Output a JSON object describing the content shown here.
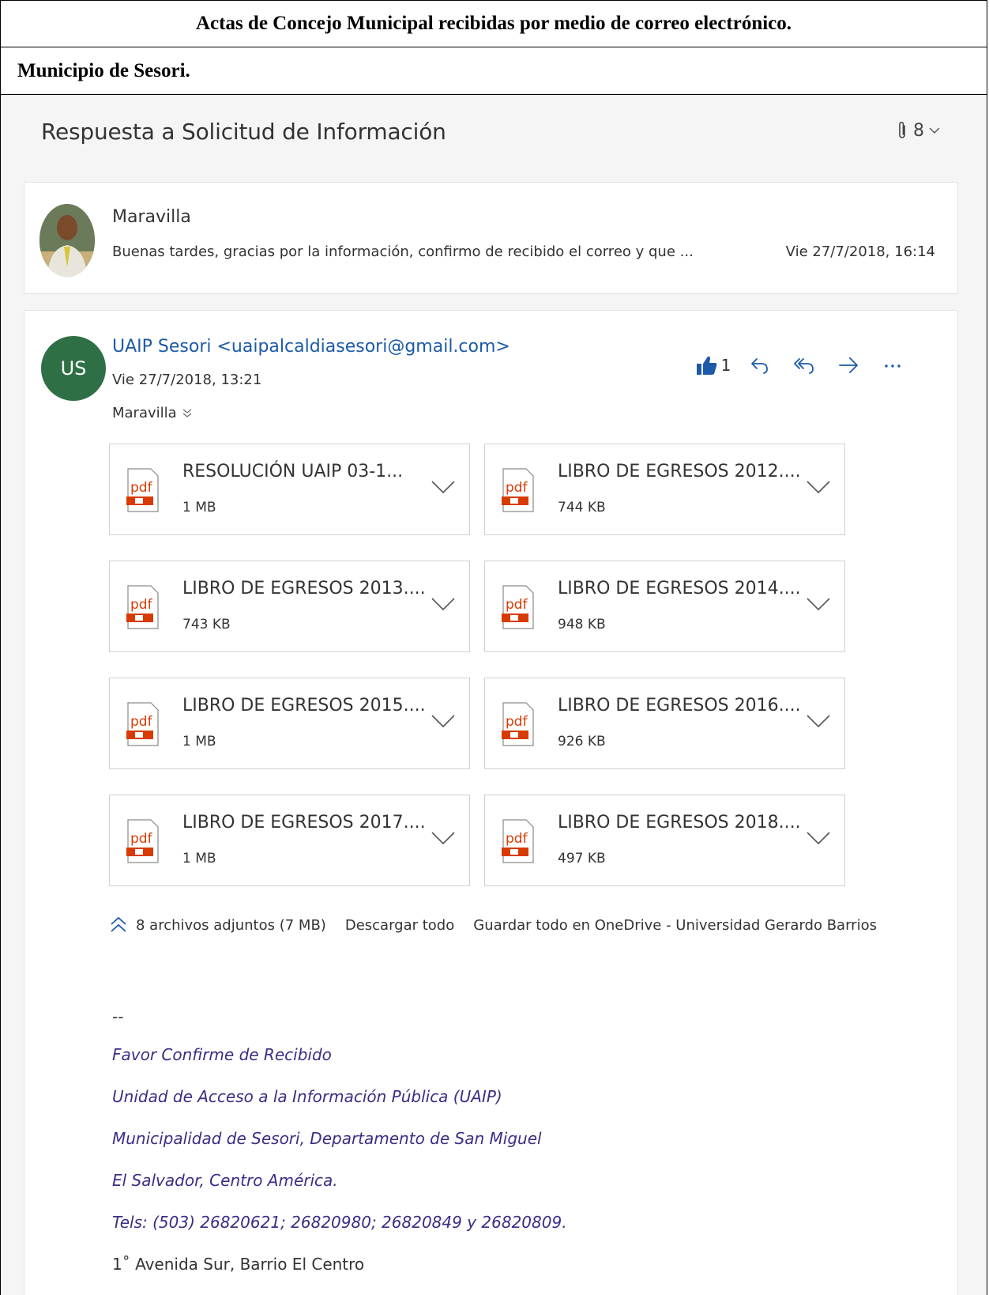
{
  "document": {
    "title": "Actas de Concejo Municipal recibidas por medio de correo electrónico.",
    "subtitle": "Municipio de Sesori."
  },
  "email": {
    "subject": "Respuesta a Solicitud de Información",
    "attachment_count": "8",
    "message_1": {
      "sender": "Maravilla",
      "preview": "Buenas tardes, gracias por la información, confirmo de recibido el correo y que ...",
      "date": "Vie 27/7/2018, 16:14"
    },
    "message_2": {
      "avatar_initials": "US",
      "avatar_color": "#2f6f45",
      "sender": "UAIP Sesori <uaipalcaldiasesori@gmail.com>",
      "date": "Vie 27/7/2018, 13:21",
      "to": "Maravilla",
      "like_count": "1"
    },
    "attachments": [
      {
        "name": "RESOLUCIÓN UAIP 03-1...",
        "size": "1 MB",
        "icon": "pdf-icon"
      },
      {
        "name": "LIBRO DE EGRESOS 2012....",
        "size": "744 KB",
        "icon": "pdf-icon"
      },
      {
        "name": "LIBRO DE EGRESOS 2013....",
        "size": "743 KB",
        "icon": "pdf-icon"
      },
      {
        "name": "LIBRO DE EGRESOS 2014....",
        "size": "948 KB",
        "icon": "pdf-icon"
      },
      {
        "name": "LIBRO DE EGRESOS 2015....",
        "size": "1 MB",
        "icon": "pdf-icon"
      },
      {
        "name": "LIBRO DE EGRESOS 2016....",
        "size": "926 KB",
        "icon": "pdf-icon"
      },
      {
        "name": "LIBRO DE EGRESOS 2017....",
        "size": "1 MB",
        "icon": "pdf-icon"
      },
      {
        "name": "LIBRO DE EGRESOS 2018....",
        "size": "497 KB",
        "icon": "pdf-icon"
      }
    ],
    "attachments_footer": {
      "summary": "8 archivos adjuntos (7 MB)",
      "download_all": "Descargar todo",
      "save_all": "Guardar todo en OneDrive - Universidad Gerardo Barrios"
    },
    "signature": {
      "separator": "--",
      "lines": [
        "Favor Confirme de Recibido",
        "Unidad de Acceso a la Información Pública (UAIP)",
        "Municipalidad de Sesori, Departamento de San Miguel",
        "El Salvador, Centro América.",
        "Tels: (503) 26820621; 26820980; 26820849 y 26820809."
      ],
      "address": "1˚ Avenida Sur, Barrio El Centro"
    },
    "colors": {
      "link_blue": "#1d5aa8",
      "signature_purple": "#3b2d86",
      "pdf_red": "#d83b01",
      "action_blue": "#1d5aa8"
    }
  }
}
